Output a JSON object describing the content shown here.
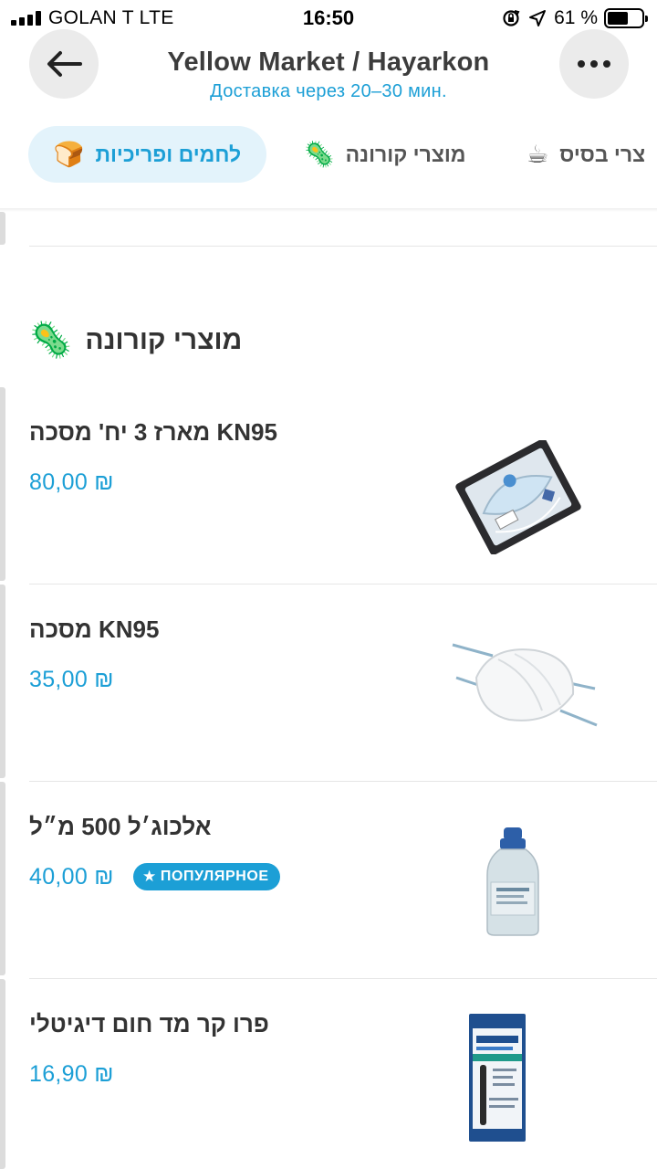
{
  "status_bar": {
    "carrier": "GOLAN T   LTE",
    "time": "16:50",
    "battery": "61 %",
    "battery_level": 0.61
  },
  "header": {
    "title": "Yellow Market / Hayarkon",
    "subtitle": "Доставка через 20–30 мин.",
    "back_icon": "arrow-left-icon",
    "more_icon": "ellipsis-icon"
  },
  "tabs": [
    {
      "label": "לחמים ופריכיות",
      "emoji": "🍞",
      "active": true
    },
    {
      "label": "מוצרי קורונה",
      "emoji": "🦠",
      "active": false
    },
    {
      "label": "צרי בסיס",
      "emoji": "☕",
      "active": false
    }
  ],
  "section": {
    "title": "מוצרי קורונה",
    "emoji": "🦠"
  },
  "items": [
    {
      "name": "מארז 3 יח' מסכה KN95",
      "price": "80,00 ₪",
      "image": "mask-pack-image"
    },
    {
      "name": "מסכה KN95",
      "price": "35,00 ₪",
      "image": "mask-image"
    },
    {
      "name": "אלכוג׳ל 500 מ״ל",
      "price": "40,00 ₪",
      "badge": "ПОПУЛЯРНОЕ",
      "image": "sanitizer-bottle-image"
    },
    {
      "name": "פרו קר מד חום דיגיטלי",
      "price": "16,90 ₪",
      "image": "thermometer-image"
    }
  ],
  "colors": {
    "accent": "#1c9fd6",
    "tab_active_bg": "#e3f3fb",
    "button_bg": "#ebebeb"
  }
}
